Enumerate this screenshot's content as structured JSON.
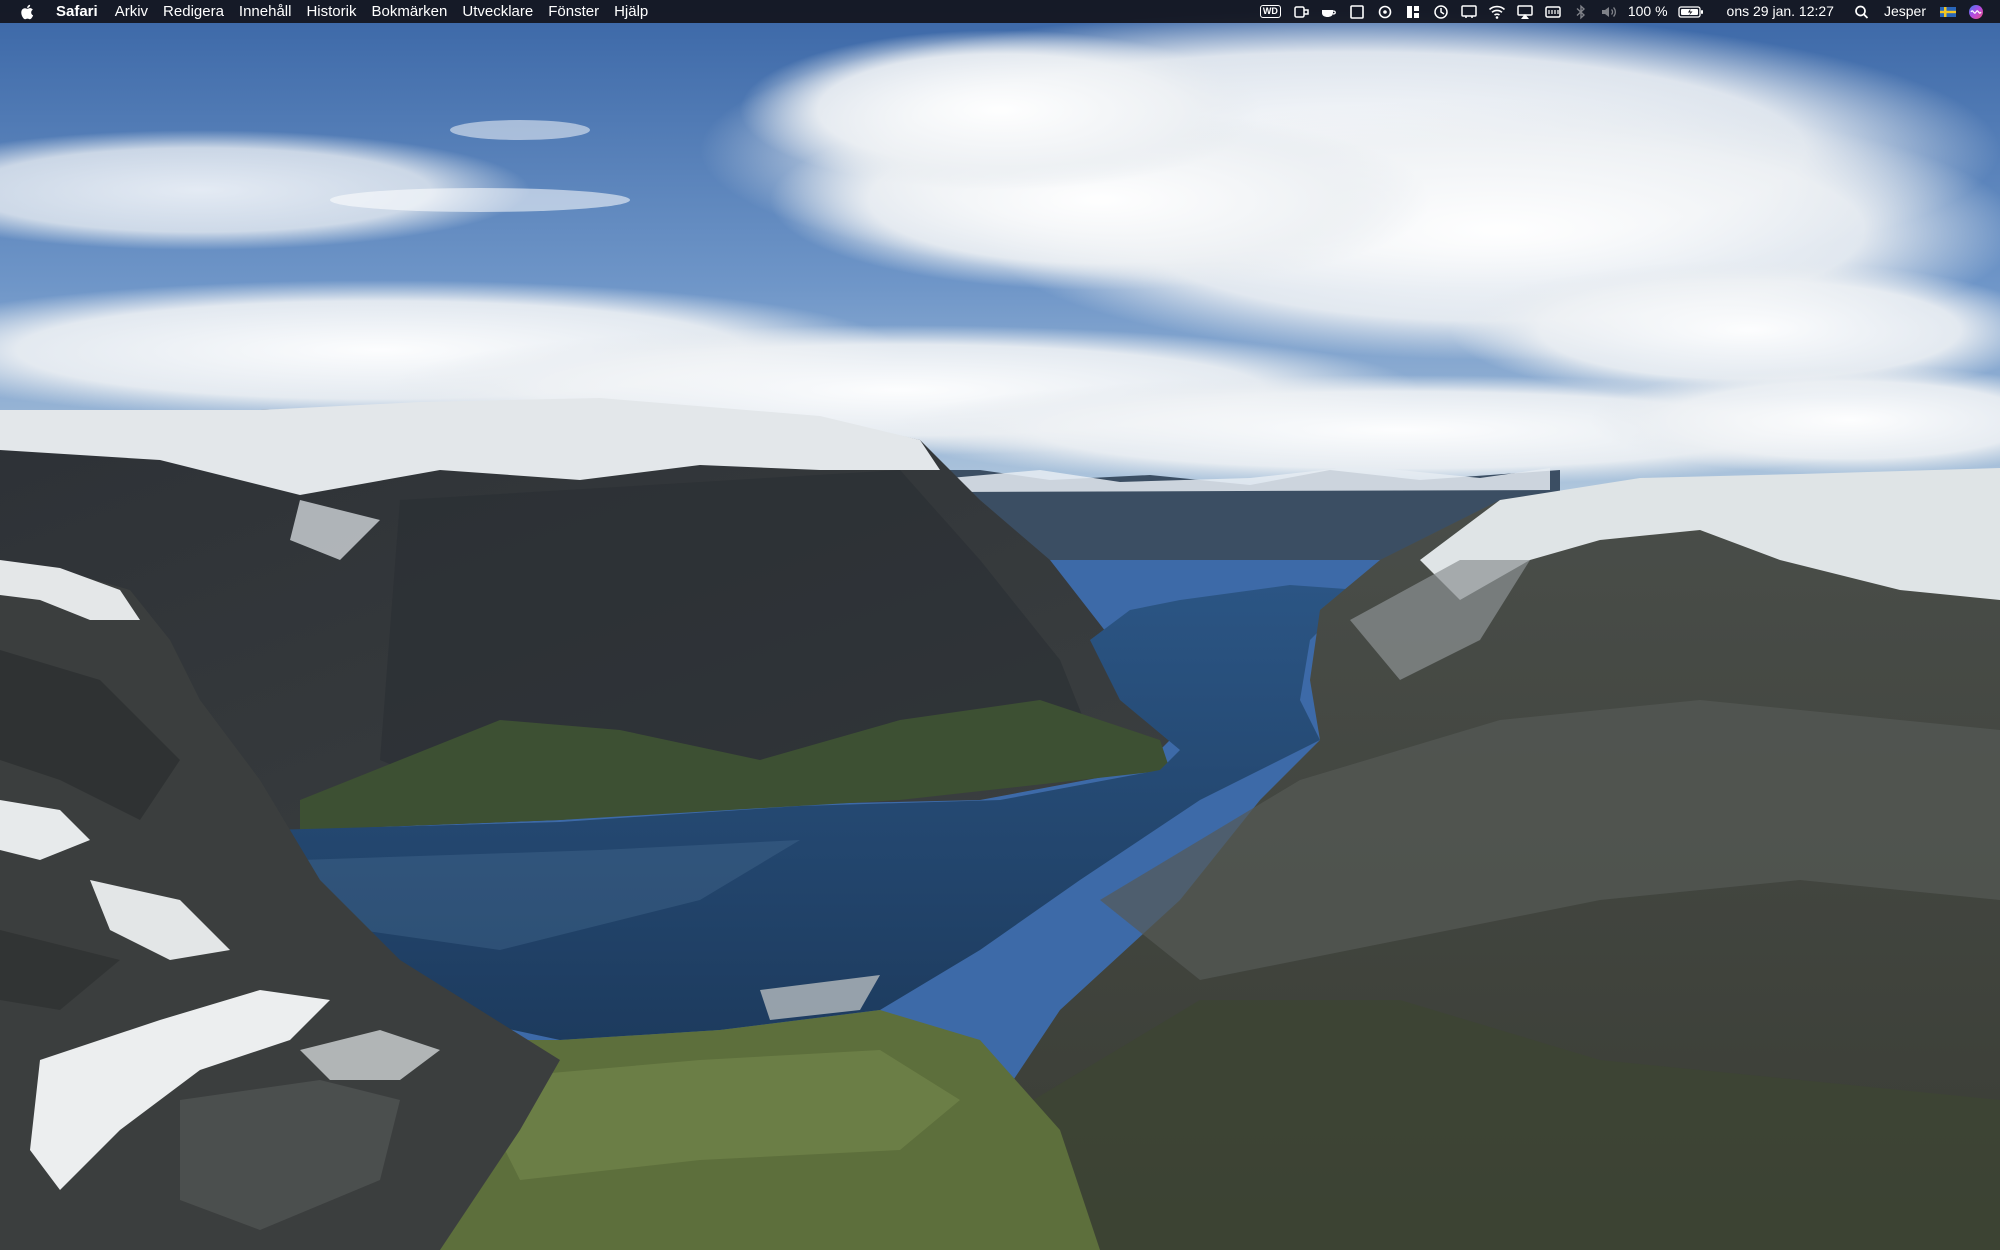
{
  "menubar": {
    "app_name": "Safari",
    "menus": [
      "Arkiv",
      "Redigera",
      "Innehåll",
      "Historik",
      "Bokmärken",
      "Utvecklare",
      "Fönster",
      "Hjälp"
    ],
    "status_icons": [
      "wd-drive-icon",
      "usb-drive-icon",
      "coffee-cup-icon",
      "window-icon",
      "istat-icon",
      "dashboard-icon",
      "time-machine-icon",
      "screen-share-icon",
      "wifi-icon",
      "airplay-icon",
      "memory-icon",
      "bluetooth-icon",
      "volume-icon"
    ],
    "wd_label": "WD",
    "battery_percent": "100 %",
    "datetime": "ons 29 jan. 12:27",
    "user": "Jesper"
  },
  "colors": {
    "menubar_bg": "#12141c",
    "sky_top": "#3d6aa8",
    "sky_bottom": "#8fb2d6",
    "water": "#22456f"
  }
}
